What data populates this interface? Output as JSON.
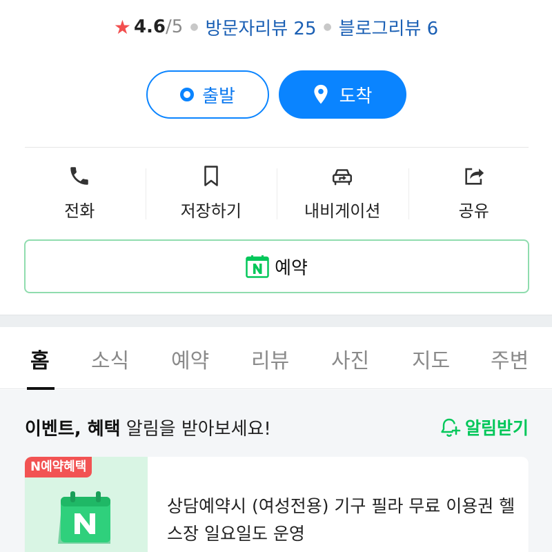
{
  "place": {
    "name": ""
  },
  "rating": {
    "star_icon": "star-icon",
    "score": "4.6",
    "score_max": "/5",
    "visitor_reviews": "방문자리뷰 25",
    "blog_reviews": "블로그리뷰 6"
  },
  "route": {
    "start_label": "출발",
    "arrive_label": "도착"
  },
  "actions": [
    {
      "label": "전화",
      "icon": "phone-icon"
    },
    {
      "label": "저장하기",
      "icon": "bookmark-icon"
    },
    {
      "label": "내비게이션",
      "icon": "car-navigation-icon"
    },
    {
      "label": "공유",
      "icon": "share-icon"
    }
  ],
  "reserve": {
    "label": "예약",
    "icon": "naver-calendar-icon"
  },
  "tabs": [
    {
      "label": "홈",
      "active": true
    },
    {
      "label": "소식"
    },
    {
      "label": "예약"
    },
    {
      "label": "리뷰"
    },
    {
      "label": "사진"
    },
    {
      "label": "지도"
    },
    {
      "label": "주변"
    }
  ],
  "alert": {
    "bold_text": "이벤트, 혜택",
    "text": " 알림을 받아보세요!",
    "button_label": "알림받기"
  },
  "event": {
    "badge": "N예약혜택",
    "text": "상담예약시 (여성전용) 기구 필라 무료 이용권 헬스장 일요일도 운영"
  },
  "colors": {
    "accent_blue": "#0a84ff",
    "naver_green": "#03c75a",
    "star_red": "#f24f4f",
    "badge_red": "#f25353"
  }
}
